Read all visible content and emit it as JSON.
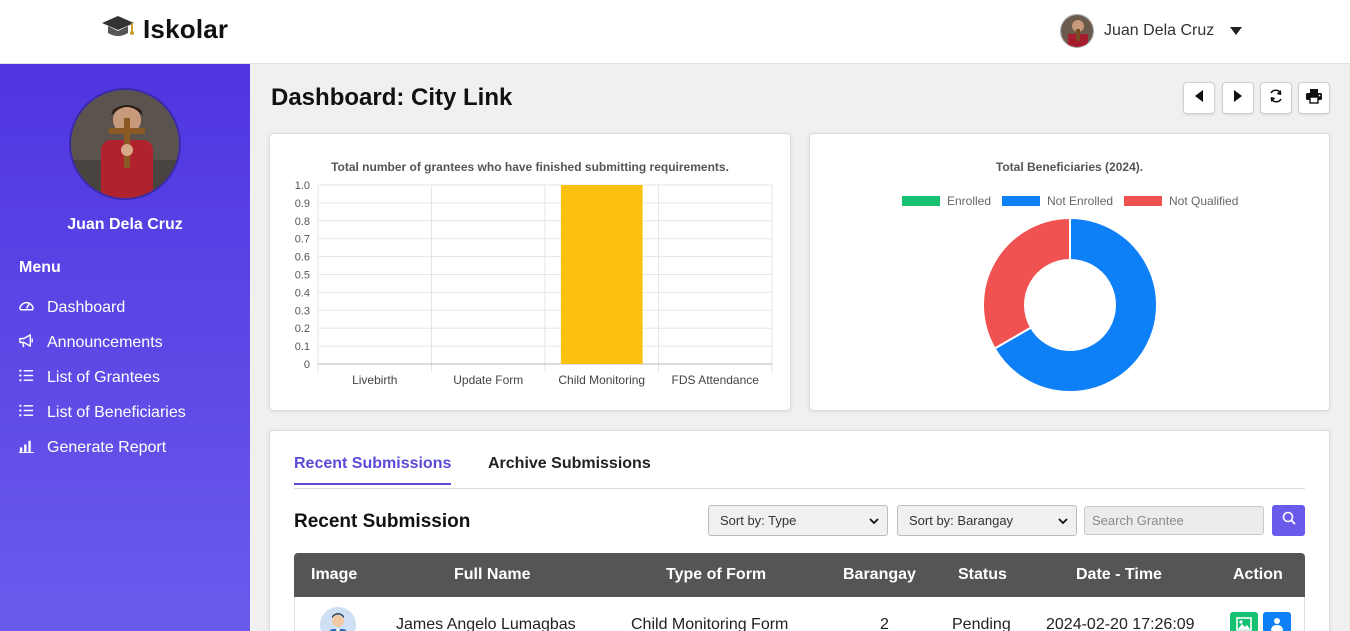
{
  "app": {
    "name": "Iskolar"
  },
  "user": {
    "name": "Juan Dela Cruz"
  },
  "sidebar": {
    "profile_name": "Juan Dela Cruz",
    "menu_title": "Menu",
    "items": [
      {
        "label": "Dashboard",
        "icon": "gauge-icon"
      },
      {
        "label": "Announcements",
        "icon": "megaphone-icon"
      },
      {
        "label": "List of Grantees",
        "icon": "list-icon"
      },
      {
        "label": "List of Beneficiaries",
        "icon": "list-icon"
      },
      {
        "label": "Generate Report",
        "icon": "bar-chart-icon"
      }
    ]
  },
  "page": {
    "title": "Dashboard: City Link"
  },
  "toolbar": [
    "prev-icon",
    "next-icon",
    "refresh-icon",
    "print-icon"
  ],
  "chart_data": [
    {
      "type": "bar",
      "title": "Total number of grantees who have finished submitting requirements.",
      "categories": [
        "Livebirth",
        "Update Form",
        "Child Monitoring",
        "FDS Attendance"
      ],
      "values": [
        0,
        0,
        1.0,
        0
      ],
      "ylim": [
        0,
        1.0
      ],
      "yticks": [
        "1.0",
        "0.9",
        "0.8",
        "0.7",
        "0.6",
        "0.5",
        "0.4",
        "0.3",
        "0.2",
        "0.1",
        "0"
      ],
      "color": "#fcc10f",
      "grid": true
    },
    {
      "type": "pie",
      "title": "Total Beneficiaries (2024).",
      "labels": [
        "Enrolled",
        "Not Enrolled",
        "Not Qualified"
      ],
      "values": [
        0,
        2,
        1
      ],
      "colors": [
        "#16c172",
        "#0d7ff7",
        "#f05252"
      ],
      "legend": "top"
    }
  ],
  "submissions": {
    "tabs": [
      "Recent Submissions",
      "Archive Submissions"
    ],
    "section_title": "Recent Submission",
    "sort_type": "Sort by: Type",
    "sort_barangay": "Sort by: Barangay",
    "search_placeholder": "Search Grantee",
    "columns": [
      "Image",
      "Full Name",
      "Type of Form",
      "Barangay",
      "Status",
      "Date - Time",
      "Action"
    ],
    "rows": [
      {
        "full_name": "James Angelo Lumagbas",
        "form": "Child Monitoring Form",
        "barangay": "2",
        "status": "Pending",
        "datetime": "2024-02-20 17:26:09"
      }
    ]
  },
  "colors": {
    "accent": "#5a4bd6",
    "sidebar_top": "#4f35e0",
    "table_head": "#555555",
    "action_green": "#16c172",
    "action_blue": "#0d7ff7"
  }
}
